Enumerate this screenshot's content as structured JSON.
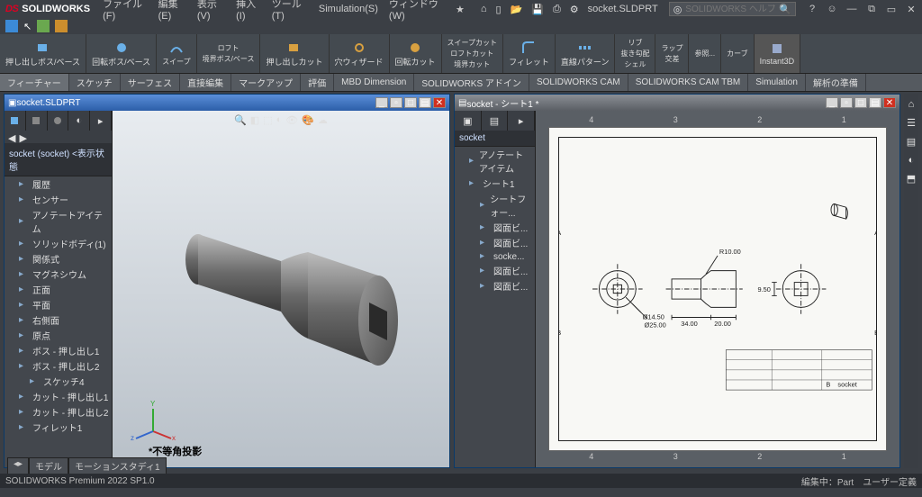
{
  "app": {
    "logo": "DS",
    "brand": "SOLIDWORKS",
    "doc_title": "socket.SLDPRT"
  },
  "search": {
    "placeholder": "SOLIDWORKS ヘルプ検索"
  },
  "menubar": [
    "ファイル(F)",
    "編集(E)",
    "表示(V)",
    "挿入(I)",
    "ツール(T)",
    "Simulation(S)",
    "ウィンドウ(W)"
  ],
  "ribbon": [
    {
      "label": "押し出しボス/ベース"
    },
    {
      "label": "回転ボス/ベース"
    },
    {
      "label": "スイープ"
    },
    {
      "label": "ロフト"
    },
    {
      "label": "境界ボス/ベース"
    },
    {
      "label": "押し出しカット"
    },
    {
      "label": "穴ウィザード"
    },
    {
      "label": "回転カット"
    },
    {
      "label": "スイープカット"
    },
    {
      "label": "ロフトカット"
    },
    {
      "label": "境界カット"
    },
    {
      "label": "フィレット"
    },
    {
      "label": "直線パターン"
    },
    {
      "label": "リブ"
    },
    {
      "label": "抜き勾配"
    },
    {
      "label": "シェル"
    },
    {
      "label": "ラップ"
    },
    {
      "label": "交差"
    },
    {
      "label": "参照..."
    },
    {
      "label": "カーブ"
    },
    {
      "label": "Instant3D"
    }
  ],
  "command_tabs": [
    "フィーチャー",
    "スケッチ",
    "サーフェス",
    "直接編集",
    "マークアップ",
    "評価",
    "MBD Dimension",
    "SOLIDWORKS アドイン",
    "SOLIDWORKS CAM",
    "SOLIDWORKS CAM TBM",
    "Simulation",
    "解析の準備"
  ],
  "doc_left": {
    "title": "socket.SLDPRT",
    "head": "socket (socket) <表示状態",
    "tree": [
      {
        "label": "履歴",
        "l": 1
      },
      {
        "label": "センサー",
        "l": 1
      },
      {
        "label": "アノテートアイテム",
        "l": 1
      },
      {
        "label": "ソリッドボディ(1)",
        "l": 1
      },
      {
        "label": "関係式",
        "l": 1
      },
      {
        "label": "マグネシウム",
        "l": 1
      },
      {
        "label": "正面",
        "l": 1
      },
      {
        "label": "平面",
        "l": 1
      },
      {
        "label": "右側面",
        "l": 1
      },
      {
        "label": "原点",
        "l": 1
      },
      {
        "label": "ボス - 押し出し1",
        "l": 1
      },
      {
        "label": "ボス - 押し出し2",
        "l": 1
      },
      {
        "label": "スケッチ4",
        "l": 2
      },
      {
        "label": "カット - 押し出し1",
        "l": 1
      },
      {
        "label": "カット - 押し出し2",
        "l": 1
      },
      {
        "label": "フィレット1",
        "l": 1
      }
    ],
    "projection": "*不等角投影"
  },
  "doc_right": {
    "title": "socket - シート1 *",
    "head": "socket",
    "tree": [
      {
        "label": "アノテートアイテム",
        "l": 1
      },
      {
        "label": "シート1",
        "l": 1
      },
      {
        "label": "シートフォー...",
        "l": 2
      },
      {
        "label": "図面ビ...",
        "l": 2
      },
      {
        "label": "図面ビ...",
        "l": 2
      },
      {
        "label": "socke...",
        "l": 2
      },
      {
        "label": "図面ビ...",
        "l": 2
      },
      {
        "label": "図面ビ...",
        "l": 2
      }
    ],
    "ruler": [
      "4",
      "3",
      "2",
      "1"
    ],
    "title_block": "socket"
  },
  "dimensions": {
    "R": "R10.00",
    "d_square": "9.50",
    "D_small": "Ø14.50",
    "D_large": "Ø25.00",
    "L_body": "34.00",
    "L_head": "20.00"
  },
  "bottom_tabs": [
    "モデル",
    "モーションスタディ1"
  ],
  "status_left": "SOLIDWORKS Premium 2022 SP1.0",
  "status_right": [
    "編集中：Part",
    "ユーザー定義"
  ]
}
